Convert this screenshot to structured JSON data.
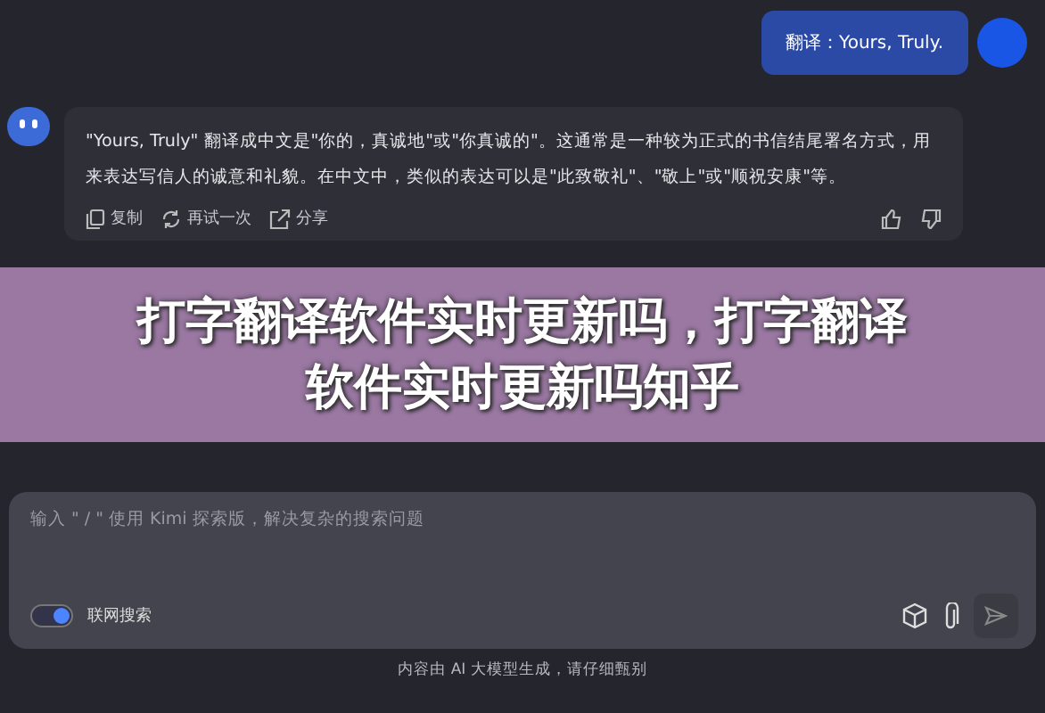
{
  "user_message": {
    "text": "翻译：Yours, Truly."
  },
  "bot_message": {
    "text": "\"Yours, Truly\" 翻译成中文是\"你的，真诚地\"或\"你真诚的\"。这通常是一种较为正式的书信结尾署名方式，用来表达写信人的诚意和礼貌。在中文中，类似的表达可以是\"此致敬礼\"、\"敬上\"或\"顺祝安康\"等。",
    "actions": [
      {
        "kind": "copy",
        "label": "复制"
      },
      {
        "kind": "retry",
        "label": "再试一次"
      },
      {
        "kind": "share",
        "label": "分享"
      }
    ]
  },
  "banner": {
    "text": "打字翻译软件实时更新吗，打字翻译软件实时更新吗知乎"
  },
  "composer": {
    "placeholder": "输入 \" / \" 使用 Kimi 探索版，解决复杂的搜索问题",
    "web_search": {
      "label": "联网搜索",
      "on": true
    }
  },
  "footer": "内容由 AI 大模型生成，请仔细甄别"
}
